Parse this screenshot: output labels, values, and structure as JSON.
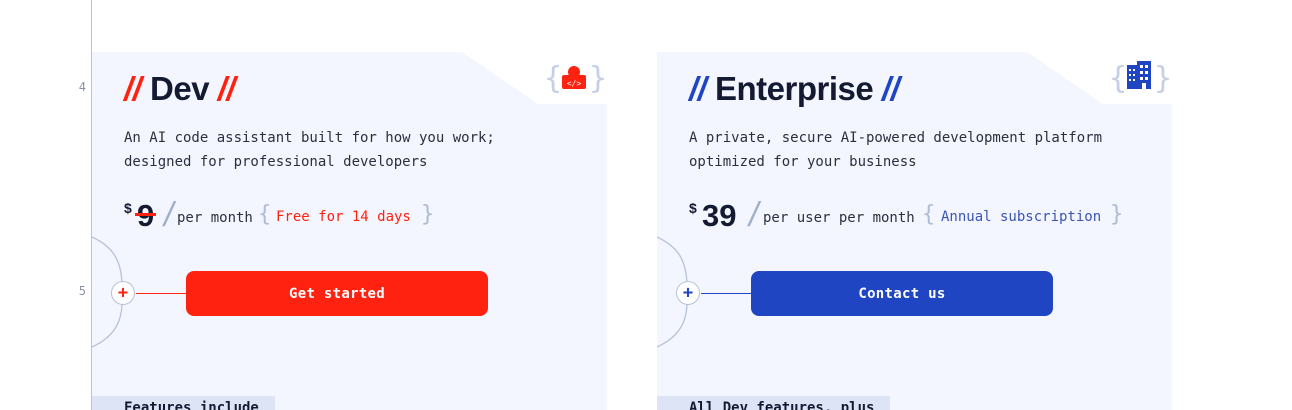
{
  "gutter": {
    "line_numbers": [
      "4",
      "5"
    ]
  },
  "plans": [
    {
      "id": "dev",
      "title": "Dev",
      "slashes": "//",
      "description_line1": "An AI code assistant built for how you work;",
      "description_line2": "designed for professional developers",
      "currency": "$",
      "price": "9",
      "price_struck": true,
      "period": "per month",
      "badge": "Free for 14 days",
      "cta_label": "Get started",
      "features_heading": "Features include",
      "icon": "basket-code-icon",
      "accent": "#ff2211"
    },
    {
      "id": "enterprise",
      "title": "Enterprise",
      "slashes": "//",
      "description_line1": "A private, secure AI-powered development platform",
      "description_line2": "optimized for your business",
      "currency": "$",
      "price": "39",
      "price_struck": false,
      "period": "per user per month",
      "badge": "Annual subscription",
      "cta_label": "Contact us",
      "features_heading": "All Dev features, plus",
      "icon": "building-icon",
      "accent": "#1f45c2"
    }
  ],
  "plus_glyph": "+",
  "brace_open": "{",
  "brace_close": "}",
  "slash_glyph": "/"
}
